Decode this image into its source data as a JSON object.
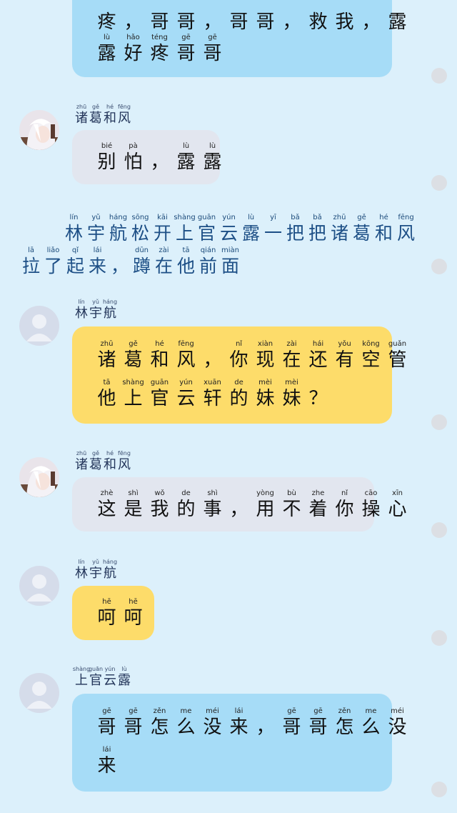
{
  "messages": [
    {
      "sender": {
        "name": "",
        "ruby": []
      },
      "lines": [
        [
          [
            "",
            "疼"
          ],
          [
            "",
            "，"
          ],
          [
            "",
            "哥"
          ],
          [
            "",
            "哥"
          ],
          [
            "",
            "，"
          ],
          [
            "",
            "哥"
          ],
          [
            "",
            "哥"
          ],
          [
            "",
            "，"
          ],
          [
            "",
            "救"
          ],
          [
            "",
            "我"
          ],
          [
            "",
            "，"
          ],
          [
            "",
            "露"
          ]
        ],
        [
          [
            "lù",
            "露"
          ],
          [
            "hǎo",
            "好"
          ],
          [
            "téng",
            "疼"
          ],
          [
            "gē",
            "哥"
          ],
          [
            "gē",
            "哥"
          ]
        ]
      ]
    },
    {
      "sender": {
        "name": "诸葛和风",
        "ruby": [
          [
            "zhū",
            "诸"
          ],
          [
            "gě",
            "葛"
          ],
          [
            "hé",
            "和"
          ],
          [
            "fēng",
            "风"
          ]
        ]
      },
      "lines": [
        [
          [
            "bié",
            "别"
          ],
          [
            "pà",
            "怕"
          ],
          [
            "",
            "，"
          ],
          [
            "lù",
            "露"
          ],
          [
            "lù",
            "露"
          ]
        ]
      ]
    },
    {
      "sender": {
        "name": "林宇航",
        "ruby": [
          [
            "lín",
            "林"
          ],
          [
            "yǔ",
            "宇"
          ],
          [
            "háng",
            "航"
          ]
        ]
      },
      "lines": [
        [
          [
            "zhū",
            "诸"
          ],
          [
            "gě",
            "葛"
          ],
          [
            "hé",
            "和"
          ],
          [
            "fēng",
            "风"
          ],
          [
            "",
            "，"
          ],
          [
            "nǐ",
            "你"
          ],
          [
            "xiàn",
            "现"
          ],
          [
            "zài",
            "在"
          ],
          [
            "hái",
            "还"
          ],
          [
            "yǒu",
            "有"
          ],
          [
            "kōng",
            "空"
          ],
          [
            "guǎn",
            "管"
          ]
        ],
        [
          [
            "tā",
            "他"
          ],
          [
            "shàng",
            "上"
          ],
          [
            "guān",
            "官"
          ],
          [
            "yún",
            "云"
          ],
          [
            "xuān",
            "轩"
          ],
          [
            "de",
            "的"
          ],
          [
            "mèi",
            "妹"
          ],
          [
            "mèi",
            "妹"
          ],
          [
            "",
            "？"
          ]
        ]
      ]
    },
    {
      "sender": {
        "name": "诸葛和风",
        "ruby": [
          [
            "zhū",
            "诸"
          ],
          [
            "gě",
            "葛"
          ],
          [
            "hé",
            "和"
          ],
          [
            "fēng",
            "风"
          ]
        ]
      },
      "lines": [
        [
          [
            "zhè",
            "这"
          ],
          [
            "shì",
            "是"
          ],
          [
            "wǒ",
            "我"
          ],
          [
            "de",
            "的"
          ],
          [
            "shì",
            "事"
          ],
          [
            "",
            "，"
          ],
          [
            "yòng",
            "用"
          ],
          [
            "bù",
            "不"
          ],
          [
            "zhe",
            "着"
          ],
          [
            "nǐ",
            "你"
          ],
          [
            "cāo",
            "操"
          ],
          [
            "xīn",
            "心"
          ]
        ]
      ]
    },
    {
      "sender": {
        "name": "林宇航",
        "ruby": [
          [
            "lín",
            "林"
          ],
          [
            "yǔ",
            "宇"
          ],
          [
            "háng",
            "航"
          ]
        ]
      },
      "lines": [
        [
          [
            "hē",
            "呵"
          ],
          [
            "hē",
            "呵"
          ]
        ]
      ]
    },
    {
      "sender": {
        "name": "上官云露",
        "ruby": [
          [
            "shàng",
            "上"
          ],
          [
            "guān",
            "官"
          ],
          [
            "yún",
            "云"
          ],
          [
            "lù",
            "露"
          ]
        ]
      },
      "lines": [
        [
          [
            "gē",
            "哥"
          ],
          [
            "gē",
            "哥"
          ],
          [
            "zěn",
            "怎"
          ],
          [
            "me",
            "么"
          ],
          [
            "méi",
            "没"
          ],
          [
            "lái",
            "来"
          ],
          [
            "",
            "，"
          ],
          [
            "gē",
            "哥"
          ],
          [
            "gē",
            "哥"
          ],
          [
            "zěn",
            "怎"
          ],
          [
            "me",
            "么"
          ],
          [
            "méi",
            "没"
          ]
        ],
        [
          [
            "lái",
            "来"
          ]
        ]
      ]
    }
  ],
  "narration": {
    "lines": [
      [
        [
          "lín",
          "林"
        ],
        [
          "yǔ",
          "宇"
        ],
        [
          "háng",
          "航"
        ],
        [
          "sōng",
          "松"
        ],
        [
          "kāi",
          "开"
        ],
        [
          "shàng",
          "上"
        ],
        [
          "guān",
          "官"
        ],
        [
          "yún",
          "云"
        ],
        [
          "lù",
          "露"
        ],
        [
          "yī",
          "一"
        ],
        [
          "bǎ",
          "把"
        ],
        [
          "bǎ",
          "把"
        ],
        [
          "zhū",
          "诸"
        ],
        [
          "gě",
          "葛"
        ],
        [
          "hé",
          "和"
        ],
        [
          "fēng",
          "风"
        ]
      ],
      [
        [
          "lā",
          "拉"
        ],
        [
          "liǎo",
          "了"
        ],
        [
          "qǐ",
          "起"
        ],
        [
          "lái",
          "来"
        ],
        [
          "",
          "，"
        ],
        [
          "dūn",
          "蹲"
        ],
        [
          "zài",
          "在"
        ],
        [
          "tā",
          "他"
        ],
        [
          "qián",
          "前"
        ],
        [
          "miàn",
          "面"
        ]
      ]
    ]
  },
  "colors": {
    "background": "#dcf0fb",
    "bubble_blue": "#a6dcf7",
    "bubble_gray": "#e2e6ef",
    "bubble_yellow": "#fddc6a",
    "narration_text": "#1d4f86",
    "name_text": "#23355a"
  },
  "icons": {
    "avatar_anime": "anime-avatar-icon",
    "avatar_default": "default-user-avatar-icon",
    "status_dot": "status-dot-icon"
  }
}
